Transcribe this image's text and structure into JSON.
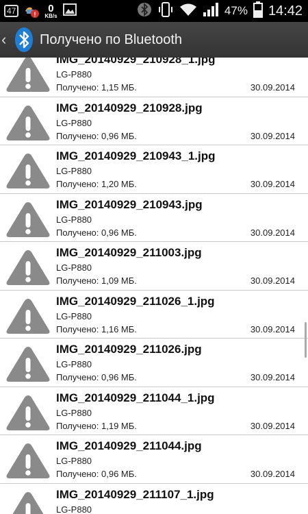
{
  "status_bar": {
    "battery_box": "47",
    "net_speed_value": "0",
    "net_speed_unit": "KB/s",
    "battery_percent": "47%",
    "time": "14:42",
    "icons": [
      "battery-level-icon",
      "notification-badge-icon",
      "image-icon",
      "bluetooth-icon",
      "phone-vibrate-icon",
      "wifi-icon",
      "signal-icon",
      "battery-icon"
    ]
  },
  "header": {
    "title": "Получено по Bluetooth",
    "icons": [
      "back-icon",
      "bluetooth-logo-icon"
    ]
  },
  "files": [
    {
      "name": "IMG_20140929_210928_1.jpg",
      "device": "LG-P880",
      "size": "Получено: 1,15 МБ.",
      "date": "30.09.2014"
    },
    {
      "name": "IMG_20140929_210928.jpg",
      "device": "LG-P880",
      "size": "Получено: 0,96 МБ.",
      "date": "30.09.2014"
    },
    {
      "name": "IMG_20140929_210943_1.jpg",
      "device": "LG-P880",
      "size": "Получено: 1,20 МБ.",
      "date": "30.09.2014"
    },
    {
      "name": "IMG_20140929_210943.jpg",
      "device": "LG-P880",
      "size": "Получено: 0,96 МБ.",
      "date": "30.09.2014"
    },
    {
      "name": "IMG_20140929_211003.jpg",
      "device": "LG-P880",
      "size": "Получено: 1,09 МБ.",
      "date": "30.09.2014"
    },
    {
      "name": "IMG_20140929_211026_1.jpg",
      "device": "LG-P880",
      "size": "Получено: 1,16 МБ.",
      "date": "30.09.2014"
    },
    {
      "name": "IMG_20140929_211026.jpg",
      "device": "LG-P880",
      "size": "Получено: 0,96 МБ.",
      "date": "30.09.2014"
    },
    {
      "name": "IMG_20140929_211044_1.jpg",
      "device": "LG-P880",
      "size": "Получено: 1,19 МБ.",
      "date": "30.09.2014"
    },
    {
      "name": "IMG_20140929_211044.jpg",
      "device": "LG-P880",
      "size": "Получено: 0,96 МБ.",
      "date": "30.09.2014"
    },
    {
      "name": "IMG_20140929_211107_1.jpg",
      "device": "LG-P880",
      "size": "",
      "date": ""
    }
  ],
  "colors": {
    "header_bg": "#3c3c3c",
    "warning_icon": "#8a8a8a",
    "divider": "#c8c8c8"
  }
}
